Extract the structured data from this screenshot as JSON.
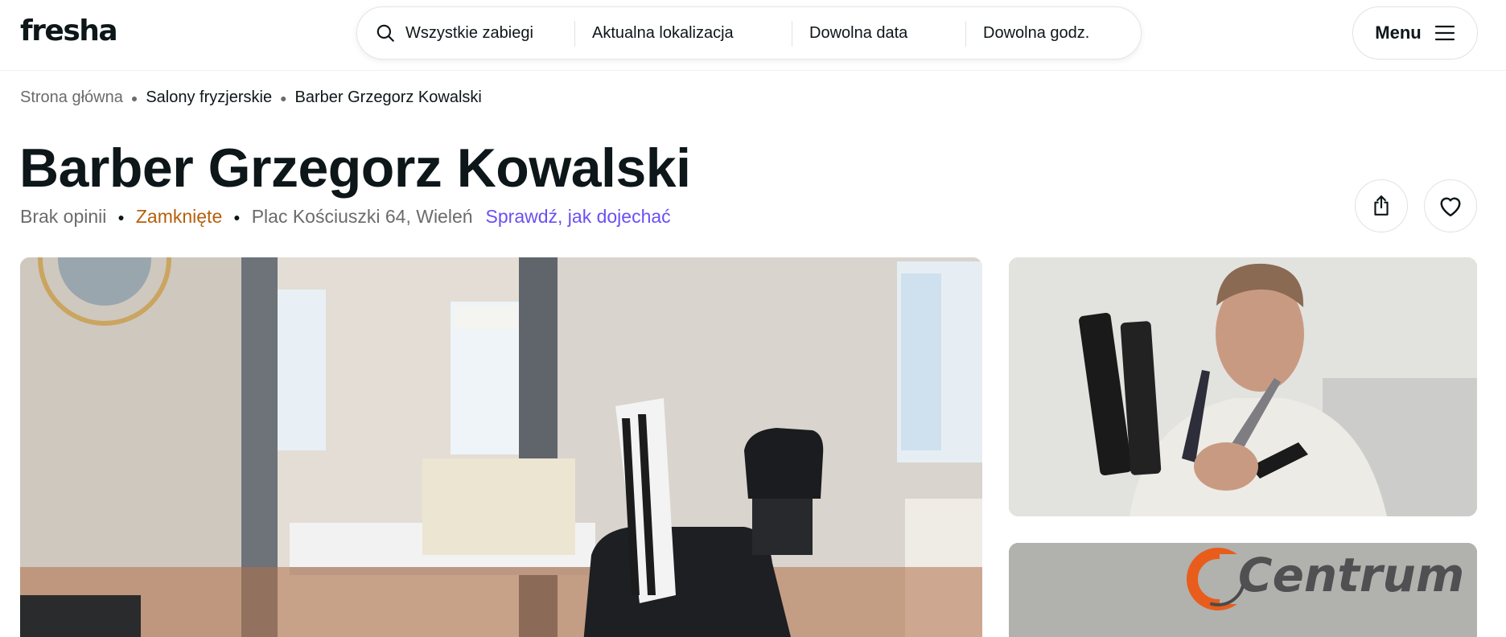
{
  "header": {
    "logo": "fresha",
    "search": {
      "treatments": "Wszystkie zabiegi",
      "location": "Aktualna lokalizacja",
      "date": "Dowolna data",
      "time": "Dowolna godz."
    },
    "menu_label": "Menu"
  },
  "breadcrumb": [
    "Strona główna",
    "Salony fryzjerskie",
    "Barber Grzegorz Kowalski"
  ],
  "venue": {
    "title": "Barber Grzegorz Kowalski",
    "reviews": "Brak opinii",
    "status": "Zamknięte",
    "address": "Plac Kościuszki 64, Wieleń",
    "directions": "Sprawdź, jak dojechać"
  },
  "gallery": {
    "side_photo_2_sign": "Centrum"
  },
  "icons": {
    "search": "search-icon",
    "menu": "hamburger-icon",
    "share": "share-icon",
    "favorite": "heart-icon"
  },
  "colors": {
    "status_closed": "#b5600d",
    "link": "#6950f3",
    "text": "#0d1619",
    "muted": "#6b6b6b"
  }
}
